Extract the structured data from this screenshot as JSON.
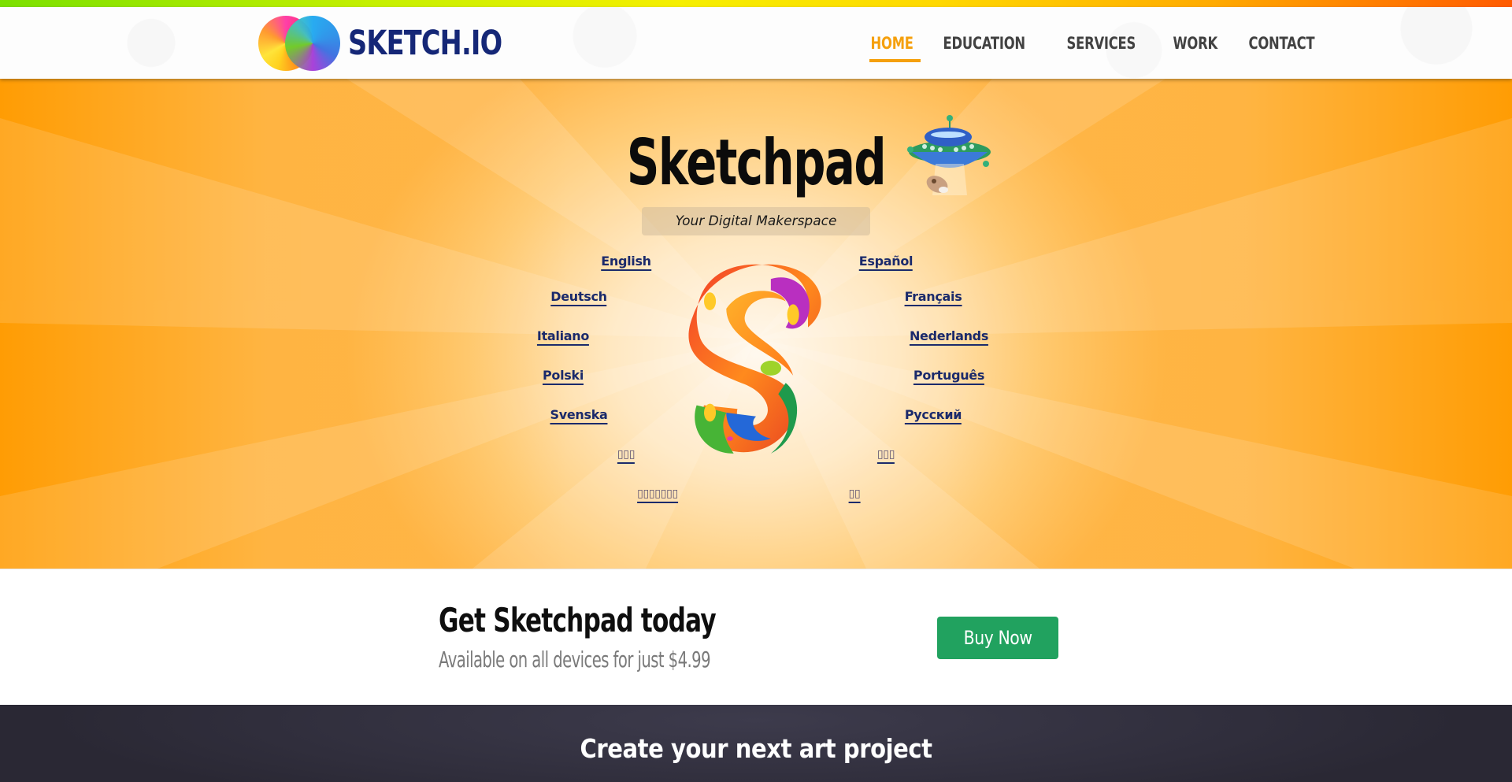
{
  "brand": {
    "name": "SKETCH.IO",
    "logo_icon": "rainbow-circles-icon"
  },
  "nav": {
    "items": [
      {
        "label": "HOME",
        "active": true
      },
      {
        "label": "EDUCATION",
        "active": false
      },
      {
        "label": "SERVICES",
        "active": false
      },
      {
        "label": "WORK",
        "active": false
      },
      {
        "label": "CONTACT",
        "active": false
      }
    ],
    "active_color": "#f5a00d",
    "text_color": "#424242"
  },
  "hero": {
    "title": "Sketchpad",
    "tagline": "Your Digital Makerspace",
    "illustration_icon": "ufo-abducting-cow-icon",
    "app_icon": "sketchpad-s-logo-icon",
    "languages_left": [
      "English",
      "Deutsch",
      "Italiano",
      "Polski",
      "Svenska",
      "▯▯▯",
      "▯▯▯▯▯▯▯"
    ],
    "languages_right": [
      "Español",
      "Français",
      "Nederlands",
      "Português",
      "Русский",
      "▯▯▯",
      "▯▯"
    ],
    "link_color": "#1b2a6b"
  },
  "cta": {
    "title": "Get Sketchpad today",
    "subtitle": "Available on all devices for just $4.99",
    "buy_label": "Buy Now",
    "buy_color": "#21a25f"
  },
  "band": {
    "title": "Create your next art project"
  }
}
